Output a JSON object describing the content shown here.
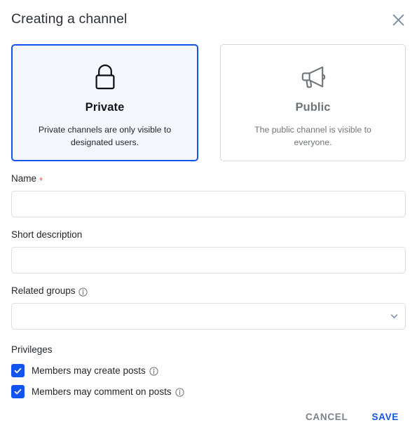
{
  "dialog": {
    "title": "Creating a channel",
    "close_icon": "close-icon"
  },
  "channel_types": {
    "options": [
      {
        "id": "private",
        "icon": "lock-icon",
        "title": "Private",
        "description": "Private channels are only visible to designated users.",
        "selected": true
      },
      {
        "id": "public",
        "icon": "megaphone-icon",
        "title": "Public",
        "description": "The public channel is visible to everyone.",
        "selected": false
      }
    ]
  },
  "form": {
    "name": {
      "label": "Name",
      "required_mark": "*",
      "value": "",
      "placeholder": ""
    },
    "short_description": {
      "label": "Short description",
      "value": "",
      "placeholder": ""
    },
    "related_groups": {
      "label": "Related groups",
      "info_icon": "info-icon",
      "value": "",
      "chevron_icon": "chevron-down-icon"
    }
  },
  "privileges": {
    "label": "Privileges",
    "items": [
      {
        "label": "Members may create posts",
        "checked": true,
        "info_icon": "info-icon"
      },
      {
        "label": "Members may comment on posts",
        "checked": true,
        "info_icon": "info-icon"
      }
    ]
  },
  "footer": {
    "cancel_label": "CANCEL",
    "save_label": "SAVE"
  },
  "colors": {
    "accent": "#1155ee",
    "selected_card_bg": "#f4f7fe",
    "required": "#f0553b",
    "muted_text": "#6f7479",
    "border": "#dcdee1"
  }
}
